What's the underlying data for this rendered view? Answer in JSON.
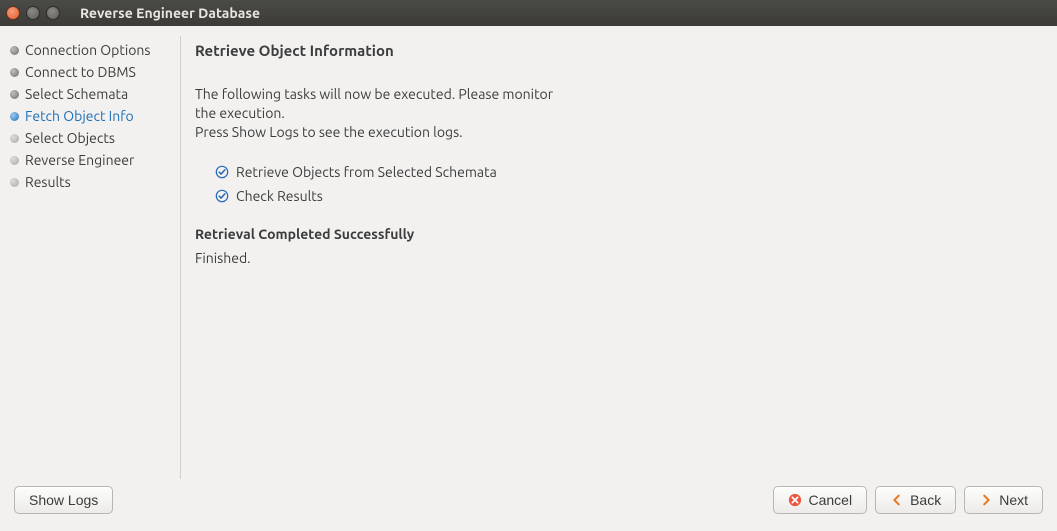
{
  "window": {
    "title": "Reverse Engineer Database"
  },
  "sidebar": {
    "steps": [
      {
        "label": "Connection Options",
        "state": "done"
      },
      {
        "label": "Connect to DBMS",
        "state": "done"
      },
      {
        "label": "Select Schemata",
        "state": "done"
      },
      {
        "label": "Fetch Object Info",
        "state": "active"
      },
      {
        "label": "Select Objects",
        "state": "future"
      },
      {
        "label": "Reverse Engineer",
        "state": "future"
      },
      {
        "label": "Results",
        "state": "future"
      }
    ]
  },
  "main": {
    "title": "Retrieve Object Information",
    "description_line1": "The following tasks will now be executed. Please monitor",
    "description_line2": "the execution.",
    "description_line3": "Press Show Logs to see the execution logs.",
    "tasks": [
      "Retrieve Objects from Selected Schemata",
      "Check Results"
    ],
    "result_title": "Retrieval Completed Successfully",
    "result_status": "Finished."
  },
  "footer": {
    "show_logs": "Show Logs",
    "cancel": "Cancel",
    "back": "Back",
    "next": "Next"
  },
  "colors": {
    "accent_orange": "#e77c2b",
    "accent_blue": "#1f6fb5",
    "bg": "#f2f1f0",
    "titlebar": "#3c3b37"
  }
}
